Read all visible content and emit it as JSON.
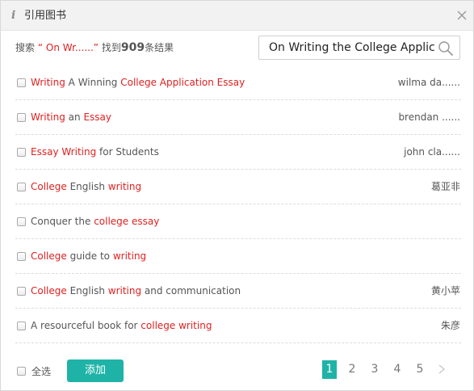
{
  "dialog": {
    "title": "引用图书",
    "info_icon": "info-icon",
    "close_icon": "close-icon"
  },
  "search": {
    "summary_prefix": "搜索",
    "summary_keyword": "“ On Wr......”",
    "summary_found": "找到",
    "summary_count": "909",
    "summary_suffix": "条结果",
    "input_value": "On Writing the College Applica",
    "search_icon": "search-icon"
  },
  "results": [
    {
      "segments": [
        {
          "t": "Writing",
          "hl": true
        },
        {
          "t": " A Winning ",
          "hl": false
        },
        {
          "t": "College Application Essay",
          "hl": true
        }
      ],
      "author": "wilma da......"
    },
    {
      "segments": [
        {
          "t": "Writing",
          "hl": true
        },
        {
          "t": " an ",
          "hl": false
        },
        {
          "t": "Essay",
          "hl": true
        }
      ],
      "author": "brendan ......"
    },
    {
      "segments": [
        {
          "t": "Essay Writing",
          "hl": true
        },
        {
          "t": " for Students",
          "hl": false
        }
      ],
      "author": "john cla......"
    },
    {
      "segments": [
        {
          "t": "College",
          "hl": true
        },
        {
          "t": " English ",
          "hl": false
        },
        {
          "t": "writing",
          "hl": true
        }
      ],
      "author": "葛亚非"
    },
    {
      "segments": [
        {
          "t": "Conquer the ",
          "hl": false
        },
        {
          "t": "college essay",
          "hl": true
        }
      ],
      "author": ""
    },
    {
      "segments": [
        {
          "t": "College",
          "hl": true
        },
        {
          "t": " guide to ",
          "hl": false
        },
        {
          "t": "writing",
          "hl": true
        }
      ],
      "author": ""
    },
    {
      "segments": [
        {
          "t": "College",
          "hl": true
        },
        {
          "t": " English ",
          "hl": false
        },
        {
          "t": "writing",
          "hl": true
        },
        {
          "t": " and communication",
          "hl": false
        }
      ],
      "author": "黄小苹"
    },
    {
      "segments": [
        {
          "t": "A resourceful book for ",
          "hl": false
        },
        {
          "t": "college writing",
          "hl": true
        }
      ],
      "author": "朱彦"
    }
  ],
  "footer": {
    "select_all_label": "全选",
    "add_button_label": "添加"
  },
  "pagination": {
    "pages": [
      "1",
      "2",
      "3",
      "4",
      "5"
    ],
    "current": "1",
    "next_icon": "chevron-right-icon"
  },
  "colors": {
    "accent": "#1fb3a7",
    "highlight": "#e02020"
  }
}
